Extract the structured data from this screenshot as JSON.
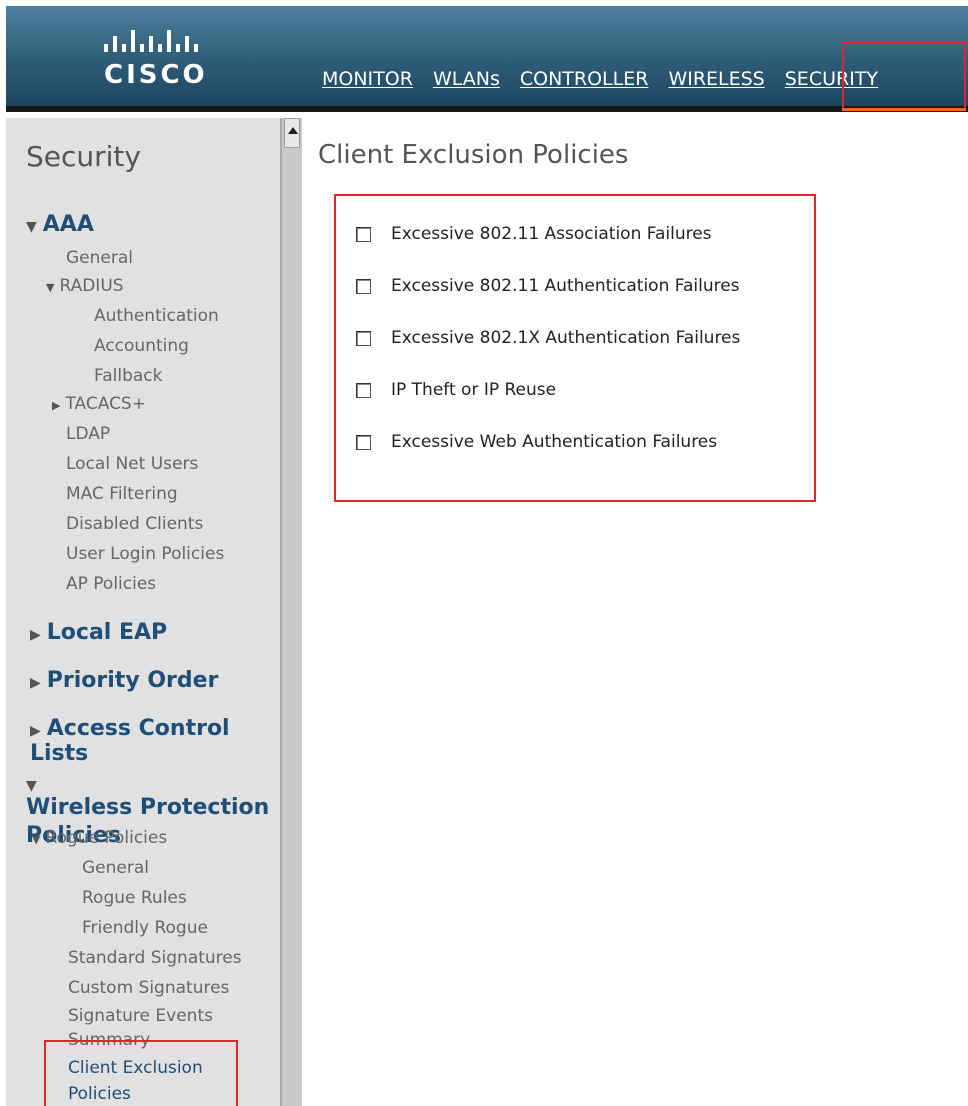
{
  "header": {
    "logo_text": "CISCO",
    "nav": [
      {
        "label": "MONITOR"
      },
      {
        "label": "WLANs"
      },
      {
        "label": "CONTROLLER"
      },
      {
        "label": "WIRELESS"
      },
      {
        "label": "SECURITY"
      }
    ],
    "active_nav": "SECURITY"
  },
  "sidebar": {
    "title": "Security",
    "aaa": {
      "label": "AAA",
      "items": [
        "General",
        "RADIUS",
        "Authentication",
        "Accounting",
        "Fallback",
        "TACACS+",
        "LDAP",
        "Local Net Users",
        "MAC Filtering",
        "Disabled Clients",
        "User Login Policies",
        "AP Policies"
      ]
    },
    "local_eap": "Local EAP",
    "priority_order": "Priority Order",
    "acl": "Access Control Lists",
    "wpp": {
      "label_line1": "Wireless Protection",
      "label_line2": "Policies",
      "items": [
        "Rogue Policies",
        "General",
        "Rogue Rules",
        "Friendly Rogue",
        "Standard Signatures",
        "Custom Signatures",
        "Signature Events",
        "Summary",
        "Client Exclusion",
        "Policies"
      ]
    }
  },
  "main": {
    "title": "Client Exclusion Policies",
    "options": [
      {
        "label": "Excessive 802.11 Association Failures",
        "checked": false
      },
      {
        "label": "Excessive 802.11 Authentication Failures",
        "checked": false
      },
      {
        "label": "Excessive 802.1X Authentication Failures",
        "checked": false
      },
      {
        "label": "IP Theft or IP Reuse",
        "checked": false
      },
      {
        "label": "Excessive Web Authentication Failures",
        "checked": false
      }
    ]
  },
  "colors": {
    "header_blue": "#2e5c78",
    "highlight_red": "#e0262a",
    "link_blue": "#1f4f78",
    "sidebar_bg": "#e1e1e1"
  }
}
